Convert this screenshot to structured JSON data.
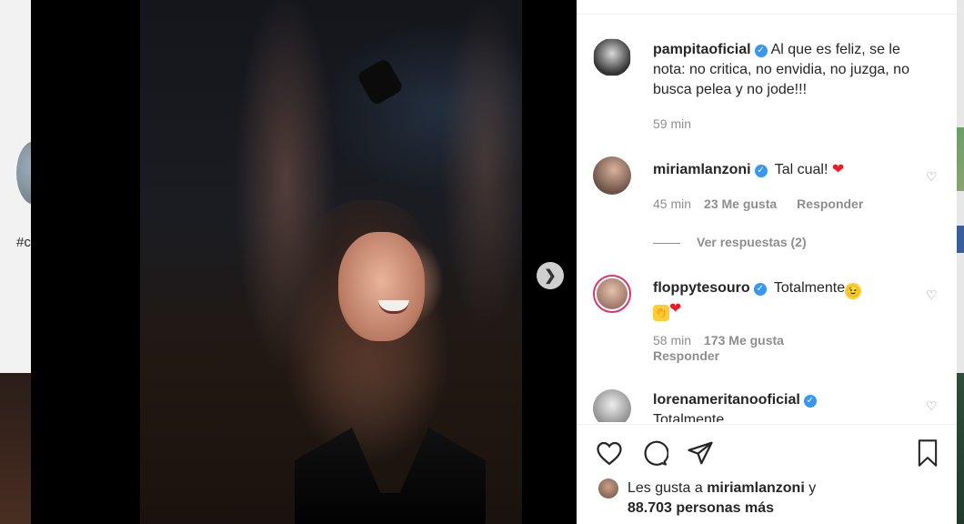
{
  "background": {
    "hashtag_fragment": "#c"
  },
  "post": {
    "author": {
      "username": "pampitaoficial",
      "verified": true
    },
    "caption": "Al que es feliz, se le nota: no critica, no envidia, no juzga, no busca pelea y no jode!!!",
    "time": "59 min"
  },
  "comments": [
    {
      "username": "miriamlanzoni",
      "verified": true,
      "text": "Tal cual!",
      "emoji": "❤",
      "time": "45 min",
      "likes": "23 Me gusta",
      "reply_label": "Responder"
    },
    {
      "username": "floppytesouro",
      "verified": true,
      "text": "Totalmente",
      "emoji_face": "😉",
      "emoji_clap": "👏",
      "emoji_heart": "❤",
      "time": "58 min",
      "likes": "173 Me gusta",
      "reply_label": "Responder"
    },
    {
      "username": "lorenameritanooficial",
      "verified": true,
      "text": "Totalmente"
    }
  ],
  "view_replies": "Ver respuestas (2)",
  "actions": {
    "like_icon": "heart-outline-icon",
    "comment_icon": "comment-bubble-icon",
    "share_icon": "paper-plane-icon",
    "save_icon": "bookmark-icon"
  },
  "likes_summary": {
    "prefix": "Les gusta a",
    "user": "miriamlanzoni",
    "connector": "y",
    "count_text": "88.703 personas más"
  },
  "colors": {
    "verified_blue": "#3897f0",
    "heart_red": "#ed1c24",
    "muted_text": "#8e8e8e"
  }
}
